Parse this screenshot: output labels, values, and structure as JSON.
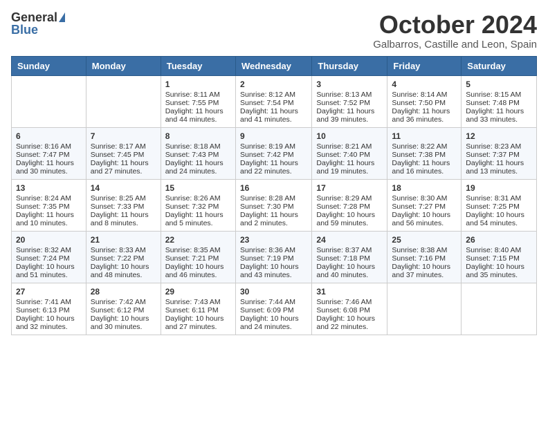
{
  "header": {
    "logo_general": "General",
    "logo_blue": "Blue",
    "month_title": "October 2024",
    "location": "Galbarros, Castille and Leon, Spain"
  },
  "days_of_week": [
    "Sunday",
    "Monday",
    "Tuesday",
    "Wednesday",
    "Thursday",
    "Friday",
    "Saturday"
  ],
  "weeks": [
    [
      {
        "day": "",
        "sunrise": "",
        "sunset": "",
        "daylight": ""
      },
      {
        "day": "",
        "sunrise": "",
        "sunset": "",
        "daylight": ""
      },
      {
        "day": "1",
        "sunrise": "Sunrise: 8:11 AM",
        "sunset": "Sunset: 7:55 PM",
        "daylight": "Daylight: 11 hours and 44 minutes."
      },
      {
        "day": "2",
        "sunrise": "Sunrise: 8:12 AM",
        "sunset": "Sunset: 7:54 PM",
        "daylight": "Daylight: 11 hours and 41 minutes."
      },
      {
        "day": "3",
        "sunrise": "Sunrise: 8:13 AM",
        "sunset": "Sunset: 7:52 PM",
        "daylight": "Daylight: 11 hours and 39 minutes."
      },
      {
        "day": "4",
        "sunrise": "Sunrise: 8:14 AM",
        "sunset": "Sunset: 7:50 PM",
        "daylight": "Daylight: 11 hours and 36 minutes."
      },
      {
        "day": "5",
        "sunrise": "Sunrise: 8:15 AM",
        "sunset": "Sunset: 7:48 PM",
        "daylight": "Daylight: 11 hours and 33 minutes."
      }
    ],
    [
      {
        "day": "6",
        "sunrise": "Sunrise: 8:16 AM",
        "sunset": "Sunset: 7:47 PM",
        "daylight": "Daylight: 11 hours and 30 minutes."
      },
      {
        "day": "7",
        "sunrise": "Sunrise: 8:17 AM",
        "sunset": "Sunset: 7:45 PM",
        "daylight": "Daylight: 11 hours and 27 minutes."
      },
      {
        "day": "8",
        "sunrise": "Sunrise: 8:18 AM",
        "sunset": "Sunset: 7:43 PM",
        "daylight": "Daylight: 11 hours and 24 minutes."
      },
      {
        "day": "9",
        "sunrise": "Sunrise: 8:19 AM",
        "sunset": "Sunset: 7:42 PM",
        "daylight": "Daylight: 11 hours and 22 minutes."
      },
      {
        "day": "10",
        "sunrise": "Sunrise: 8:21 AM",
        "sunset": "Sunset: 7:40 PM",
        "daylight": "Daylight: 11 hours and 19 minutes."
      },
      {
        "day": "11",
        "sunrise": "Sunrise: 8:22 AM",
        "sunset": "Sunset: 7:38 PM",
        "daylight": "Daylight: 11 hours and 16 minutes."
      },
      {
        "day": "12",
        "sunrise": "Sunrise: 8:23 AM",
        "sunset": "Sunset: 7:37 PM",
        "daylight": "Daylight: 11 hours and 13 minutes."
      }
    ],
    [
      {
        "day": "13",
        "sunrise": "Sunrise: 8:24 AM",
        "sunset": "Sunset: 7:35 PM",
        "daylight": "Daylight: 11 hours and 10 minutes."
      },
      {
        "day": "14",
        "sunrise": "Sunrise: 8:25 AM",
        "sunset": "Sunset: 7:33 PM",
        "daylight": "Daylight: 11 hours and 8 minutes."
      },
      {
        "day": "15",
        "sunrise": "Sunrise: 8:26 AM",
        "sunset": "Sunset: 7:32 PM",
        "daylight": "Daylight: 11 hours and 5 minutes."
      },
      {
        "day": "16",
        "sunrise": "Sunrise: 8:28 AM",
        "sunset": "Sunset: 7:30 PM",
        "daylight": "Daylight: 11 hours and 2 minutes."
      },
      {
        "day": "17",
        "sunrise": "Sunrise: 8:29 AM",
        "sunset": "Sunset: 7:28 PM",
        "daylight": "Daylight: 10 hours and 59 minutes."
      },
      {
        "day": "18",
        "sunrise": "Sunrise: 8:30 AM",
        "sunset": "Sunset: 7:27 PM",
        "daylight": "Daylight: 10 hours and 56 minutes."
      },
      {
        "day": "19",
        "sunrise": "Sunrise: 8:31 AM",
        "sunset": "Sunset: 7:25 PM",
        "daylight": "Daylight: 10 hours and 54 minutes."
      }
    ],
    [
      {
        "day": "20",
        "sunrise": "Sunrise: 8:32 AM",
        "sunset": "Sunset: 7:24 PM",
        "daylight": "Daylight: 10 hours and 51 minutes."
      },
      {
        "day": "21",
        "sunrise": "Sunrise: 8:33 AM",
        "sunset": "Sunset: 7:22 PM",
        "daylight": "Daylight: 10 hours and 48 minutes."
      },
      {
        "day": "22",
        "sunrise": "Sunrise: 8:35 AM",
        "sunset": "Sunset: 7:21 PM",
        "daylight": "Daylight: 10 hours and 46 minutes."
      },
      {
        "day": "23",
        "sunrise": "Sunrise: 8:36 AM",
        "sunset": "Sunset: 7:19 PM",
        "daylight": "Daylight: 10 hours and 43 minutes."
      },
      {
        "day": "24",
        "sunrise": "Sunrise: 8:37 AM",
        "sunset": "Sunset: 7:18 PM",
        "daylight": "Daylight: 10 hours and 40 minutes."
      },
      {
        "day": "25",
        "sunrise": "Sunrise: 8:38 AM",
        "sunset": "Sunset: 7:16 PM",
        "daylight": "Daylight: 10 hours and 37 minutes."
      },
      {
        "day": "26",
        "sunrise": "Sunrise: 8:40 AM",
        "sunset": "Sunset: 7:15 PM",
        "daylight": "Daylight: 10 hours and 35 minutes."
      }
    ],
    [
      {
        "day": "27",
        "sunrise": "Sunrise: 7:41 AM",
        "sunset": "Sunset: 6:13 PM",
        "daylight": "Daylight: 10 hours and 32 minutes."
      },
      {
        "day": "28",
        "sunrise": "Sunrise: 7:42 AM",
        "sunset": "Sunset: 6:12 PM",
        "daylight": "Daylight: 10 hours and 30 minutes."
      },
      {
        "day": "29",
        "sunrise": "Sunrise: 7:43 AM",
        "sunset": "Sunset: 6:11 PM",
        "daylight": "Daylight: 10 hours and 27 minutes."
      },
      {
        "day": "30",
        "sunrise": "Sunrise: 7:44 AM",
        "sunset": "Sunset: 6:09 PM",
        "daylight": "Daylight: 10 hours and 24 minutes."
      },
      {
        "day": "31",
        "sunrise": "Sunrise: 7:46 AM",
        "sunset": "Sunset: 6:08 PM",
        "daylight": "Daylight: 10 hours and 22 minutes."
      },
      {
        "day": "",
        "sunrise": "",
        "sunset": "",
        "daylight": ""
      },
      {
        "day": "",
        "sunrise": "",
        "sunset": "",
        "daylight": ""
      }
    ]
  ]
}
